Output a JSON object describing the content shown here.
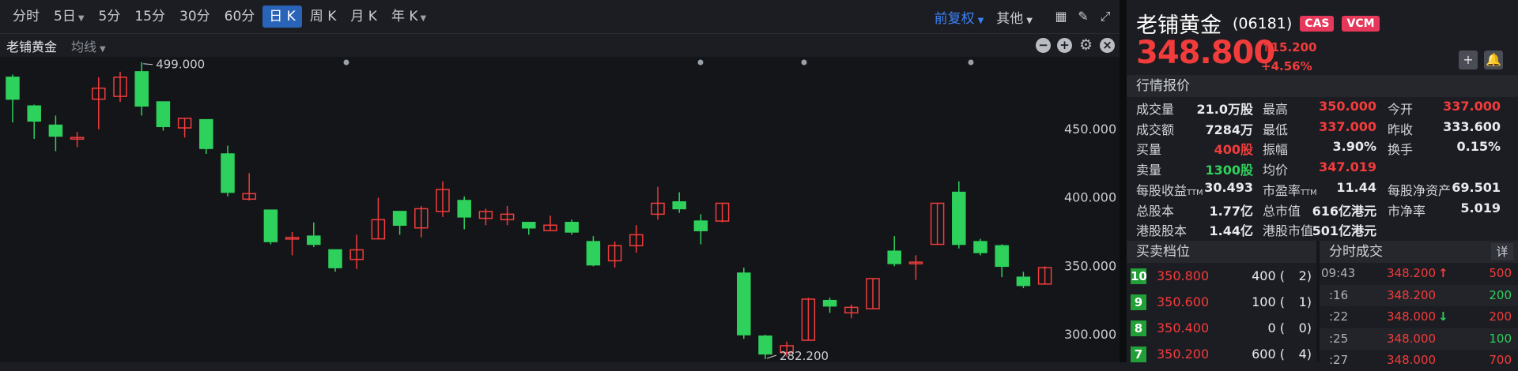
{
  "toolbar": {
    "tabs": [
      {
        "label": "分时"
      },
      {
        "label": "5日",
        "dropdown": true
      },
      {
        "label": "5分"
      },
      {
        "label": "15分"
      },
      {
        "label": "30分"
      },
      {
        "label": "60分"
      },
      {
        "label": "日 K",
        "active": true
      },
      {
        "label": "周 K"
      },
      {
        "label": "月 K"
      },
      {
        "label": "年 K",
        "dropdown": true
      }
    ],
    "fuquan": "前复权",
    "other": "其他",
    "icons": [
      "layout-icon",
      "draw-pen-icon",
      "fullscreen-icon"
    ]
  },
  "subbar": {
    "name": "老铺黄金",
    "indicator": "均线",
    "icons": [
      "minus-icon",
      "plus-icon",
      "gear-icon",
      "close-icon"
    ]
  },
  "chart_data": {
    "type": "candlestick",
    "y_ticks": [
      "450.000",
      "400.000",
      "350.000",
      "300.000"
    ],
    "ylim": [
      277,
      500
    ],
    "annotations": {
      "high": "499.000",
      "low": "282.200"
    },
    "up_color": "#f23c3c",
    "down_color": "#2ed15c",
    "candles": [
      {
        "o": 488,
        "c": 472,
        "h": 490,
        "l": 455
      },
      {
        "o": 467,
        "c": 456,
        "h": 468,
        "l": 443
      },
      {
        "o": 453,
        "c": 445,
        "h": 460,
        "l": 434
      },
      {
        "o": 443,
        "c": 444,
        "h": 448,
        "l": 437
      },
      {
        "o": 472,
        "c": 480,
        "h": 488,
        "l": 450
      },
      {
        "o": 474,
        "c": 488,
        "h": 492,
        "l": 470
      },
      {
        "o": 492,
        "c": 467,
        "h": 499,
        "l": 460
      },
      {
        "o": 470,
        "c": 452,
        "h": 470,
        "l": 449
      },
      {
        "o": 451,
        "c": 458,
        "h": 458,
        "l": 444
      },
      {
        "o": 457,
        "c": 436,
        "h": 457,
        "l": 432
      },
      {
        "o": 432,
        "c": 404,
        "h": 438,
        "l": 401
      },
      {
        "o": 399,
        "c": 403,
        "h": 418,
        "l": 398
      },
      {
        "o": 391,
        "c": 368,
        "h": 391,
        "l": 366
      },
      {
        "o": 370,
        "c": 371,
        "h": 375,
        "l": 358
      },
      {
        "o": 372,
        "c": 366,
        "h": 382,
        "l": 364
      },
      {
        "o": 362,
        "c": 349,
        "h": 362,
        "l": 346
      },
      {
        "o": 355,
        "c": 362,
        "h": 373,
        "l": 348
      },
      {
        "o": 370,
        "c": 384,
        "h": 400,
        "l": 370
      },
      {
        "o": 390,
        "c": 380,
        "h": 390,
        "l": 373
      },
      {
        "o": 378,
        "c": 392,
        "h": 394,
        "l": 371
      },
      {
        "o": 390,
        "c": 406,
        "h": 412,
        "l": 386
      },
      {
        "o": 398,
        "c": 386,
        "h": 401,
        "l": 377
      },
      {
        "o": 385,
        "c": 390,
        "h": 392,
        "l": 380
      },
      {
        "o": 384,
        "c": 388,
        "h": 394,
        "l": 380
      },
      {
        "o": 382,
        "c": 378,
        "h": 382,
        "l": 373
      },
      {
        "o": 376,
        "c": 380,
        "h": 387,
        "l": 376
      },
      {
        "o": 382,
        "c": 375,
        "h": 384,
        "l": 373
      },
      {
        "o": 368,
        "c": 351,
        "h": 372,
        "l": 350
      },
      {
        "o": 354,
        "c": 365,
        "h": 368,
        "l": 349
      },
      {
        "o": 365,
        "c": 373,
        "h": 380,
        "l": 360
      },
      {
        "o": 388,
        "c": 396,
        "h": 408,
        "l": 384
      },
      {
        "o": 397,
        "c": 392,
        "h": 404,
        "l": 389
      },
      {
        "o": 383,
        "c": 376,
        "h": 388,
        "l": 366
      },
      {
        "o": 383,
        "c": 396,
        "h": 396,
        "l": 382
      },
      {
        "o": 345,
        "c": 300,
        "h": 349,
        "l": 297
      },
      {
        "o": 299,
        "c": 286,
        "h": 300,
        "l": 282.2
      },
      {
        "o": 287,
        "c": 292,
        "h": 295,
        "l": 284
      },
      {
        "o": 296,
        "c": 326,
        "h": 327,
        "l": 296
      },
      {
        "o": 325,
        "c": 321,
        "h": 327,
        "l": 316
      },
      {
        "o": 316,
        "c": 320,
        "h": 322,
        "l": 312
      },
      {
        "o": 319,
        "c": 341,
        "h": 341,
        "l": 319
      },
      {
        "o": 361,
        "c": 352,
        "h": 372,
        "l": 350
      },
      {
        "o": 352,
        "c": 353,
        "h": 358,
        "l": 340
      },
      {
        "o": 366,
        "c": 396,
        "h": 396,
        "l": 366
      },
      {
        "o": 404,
        "c": 366,
        "h": 412,
        "l": 363
      },
      {
        "o": 368,
        "c": 360,
        "h": 370,
        "l": 358
      },
      {
        "o": 365,
        "c": 350,
        "h": 366,
        "l": 342
      },
      {
        "o": 342,
        "c": 336,
        "h": 346,
        "l": 334
      },
      {
        "o": 337,
        "c": 349,
        "h": 350,
        "l": 337
      }
    ]
  },
  "quote": {
    "name": "老铺黄金",
    "code": "(06181)",
    "badges": [
      "CAS",
      "VCM"
    ],
    "price": "348.800",
    "change": "↑15.200",
    "change_pct": "+4.56%",
    "section_title": "行情报价",
    "rows": [
      [
        {
          "l": "成交量",
          "v": "21.0万股"
        },
        {
          "l": "最高",
          "v": "350.000",
          "c": "red"
        },
        {
          "l": "今开",
          "v": "337.000",
          "c": "red"
        }
      ],
      [
        {
          "l": "成交额",
          "v": "7284万"
        },
        {
          "l": "最低",
          "v": "337.000",
          "c": "red"
        },
        {
          "l": "昨收",
          "v": "333.600"
        }
      ],
      [
        {
          "l": "买量",
          "v": "400股",
          "c": "red"
        },
        {
          "l": "振幅",
          "v": "3.90%"
        },
        {
          "l": "换手",
          "v": "0.15%"
        }
      ],
      [
        {
          "l": "卖量",
          "v": "1300股",
          "c": "green"
        },
        {
          "l": "均价",
          "v": "347.019",
          "c": "red"
        },
        {
          "l": "",
          "v": ""
        }
      ],
      [
        {
          "l": "每股收益",
          "sub": "TTM",
          "v": "30.493"
        },
        {
          "l": "市盈率",
          "sub": "TTM",
          "v": "11.44"
        },
        {
          "l": "每股净资产",
          "v": "69.501"
        }
      ],
      [
        {
          "l": "总股本",
          "v": "1.77亿"
        },
        {
          "l": "总市值",
          "v": "616亿港元"
        },
        {
          "l": "市净率",
          "v": "5.019"
        }
      ],
      [
        {
          "l": "港股股本",
          "v": "1.44亿"
        },
        {
          "l": "港股市值",
          "v": "501亿港元"
        },
        {
          "l": "",
          "v": ""
        }
      ]
    ]
  },
  "orderbook": {
    "title": "买卖档位",
    "rows": [
      {
        "level": "10",
        "price": "350.800",
        "qty": "400 (",
        "orders": "2)"
      },
      {
        "level": "9",
        "price": "350.600",
        "qty": "100 (",
        "orders": "1)"
      },
      {
        "level": "8",
        "price": "350.400",
        "qty": "0 (",
        "orders": "0)"
      },
      {
        "level": "7",
        "price": "350.200",
        "qty": "600 (",
        "orders": "4)"
      }
    ]
  },
  "ticks": {
    "title": "分时成交",
    "detail": "详",
    "rows": [
      {
        "time": "09:43",
        "price": "348.200",
        "arrow": "↑",
        "vol": "500"
      },
      {
        "time": ":16",
        "price": "348.200",
        "arrow": "",
        "vol": "200"
      },
      {
        "time": ":22",
        "price": "348.000",
        "arrow": "↓",
        "vol": "200"
      },
      {
        "time": ":25",
        "price": "348.000",
        "arrow": "",
        "vol": "100"
      },
      {
        "time": ":27",
        "price": "348.000",
        "arrow": "",
        "vol": "700"
      }
    ]
  }
}
